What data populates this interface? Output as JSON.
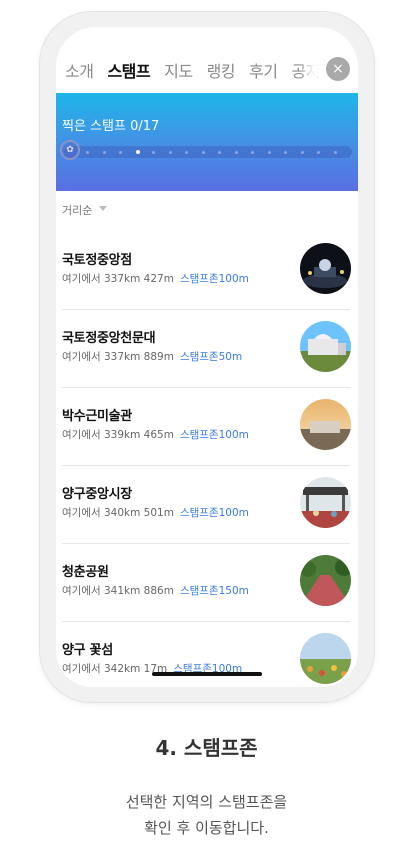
{
  "tabs": [
    "소개",
    "스탬프",
    "지도",
    "랭킹",
    "후기",
    "공지"
  ],
  "active_tab": 1,
  "close_label": "×",
  "banner": {
    "title": "찍은 스탬프 0/17",
    "collected": 0,
    "total": 17,
    "current_index": 4
  },
  "sort": {
    "label": "거리순"
  },
  "places": [
    {
      "name": "국토정중앙점",
      "distance": "여기에서 337km 427m",
      "zone": "스탬프존100m",
      "thumb": "night-plaza"
    },
    {
      "name": "국토정중앙천문대",
      "distance": "여기에서 337km 889m",
      "zone": "스탬프존50m",
      "thumb": "observatory"
    },
    {
      "name": "박수근미술관",
      "distance": "여기에서 339km 465m",
      "zone": "스탬프존100m",
      "thumb": "museum-sunset"
    },
    {
      "name": "양구중앙시장",
      "distance": "여기에서 340km 501m",
      "zone": "스탬프존100m",
      "thumb": "market-gate"
    },
    {
      "name": "청춘공원",
      "distance": "여기에서 341km 886m",
      "zone": "스탬프존150m",
      "thumb": "park-path"
    },
    {
      "name": "양구 꽃섬",
      "distance": "여기에서 342km 17m",
      "zone": "스탬프존100m",
      "thumb": "flower-field"
    }
  ],
  "caption": {
    "title": "4. 스탬프존",
    "line1": "선택한 지역의 스탬프존을",
    "line2": "확인 후 이동합니다."
  }
}
